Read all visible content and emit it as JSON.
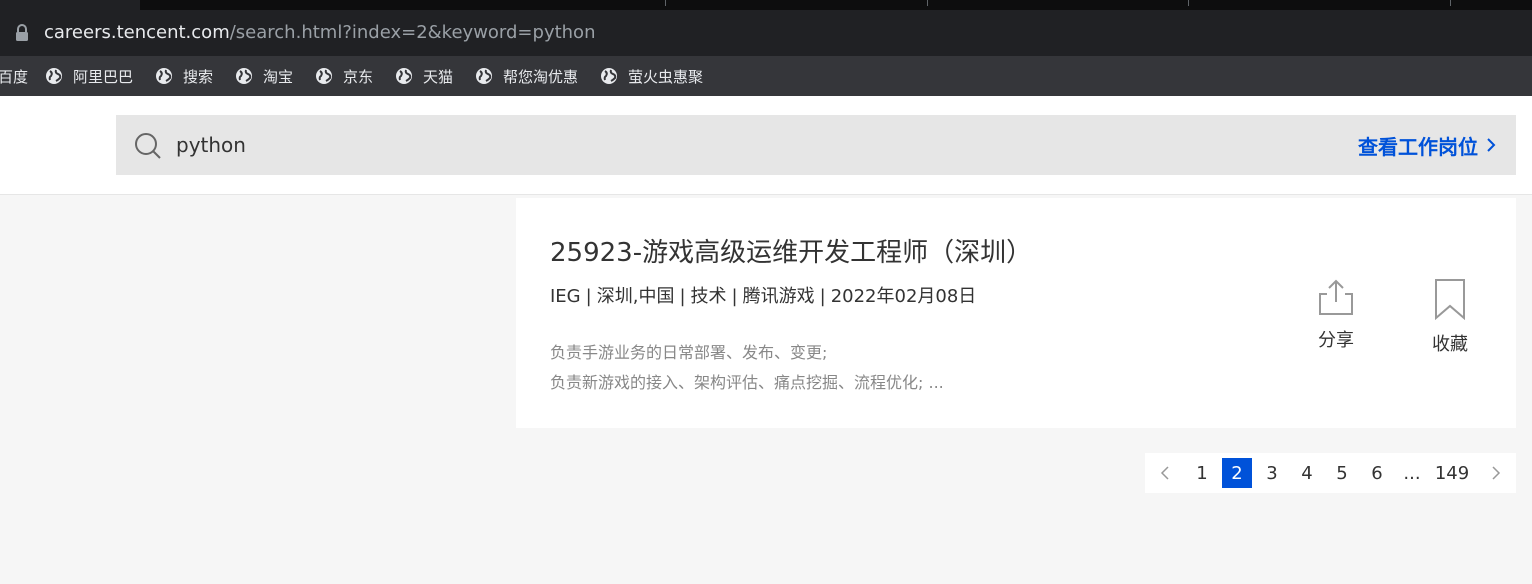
{
  "browser": {
    "url_host": "careers.tencent.com",
    "url_path": "/search.html?index=2&keyword=python",
    "bookmarks": [
      {
        "label": "百度",
        "icon": "none"
      },
      {
        "label": "阿里巴巴",
        "icon": "globe-icon"
      },
      {
        "label": "搜索",
        "icon": "globe-icon"
      },
      {
        "label": "淘宝",
        "icon": "globe-icon"
      },
      {
        "label": "京东",
        "icon": "globe-icon"
      },
      {
        "label": "天猫",
        "icon": "globe-icon"
      },
      {
        "label": "帮您淘优惠",
        "icon": "globe-icon"
      },
      {
        "label": "萤火虫惠聚",
        "icon": "globe-icon"
      }
    ]
  },
  "search": {
    "value": "python",
    "view_jobs_label": "查看工作岗位"
  },
  "job": {
    "title": "25923-游戏高级运维开发工程师（深圳）",
    "meta": [
      "IEG",
      "深圳,中国",
      "技术",
      "腾讯游戏",
      "2022年02月08日"
    ],
    "desc": [
      "负责手游业务的日常部署、发布、变更;",
      "负责新游戏的接入、架构评估、痛点挖掘、流程优化; ..."
    ],
    "share_label": "分享",
    "favorite_label": "收藏"
  },
  "pagination": {
    "pages": [
      "1",
      "2",
      "3",
      "4",
      "5",
      "6",
      "...",
      "149"
    ],
    "current": "2"
  },
  "colors": {
    "accent": "#0052d9",
    "chrome_dark": "#202124",
    "bookmark_bar": "#35363a",
    "page_bg": "#f6f6f6"
  }
}
